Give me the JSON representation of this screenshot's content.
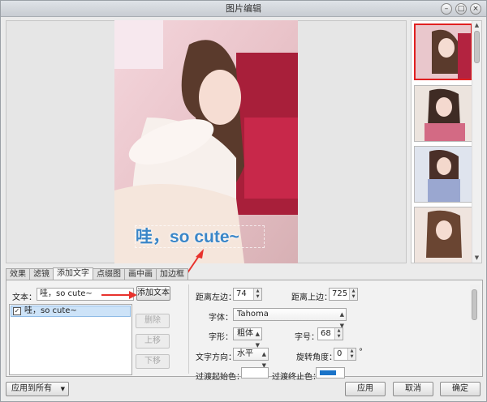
{
  "window": {
    "title": "图片编辑",
    "minimize_icon": "minimize-icon",
    "maximize_icon": "maximize-icon",
    "close_icon": "close-icon"
  },
  "preview": {
    "overlay_text": "哇，so cute~",
    "overlay_color": "#3a86c8"
  },
  "thumbnails": {
    "count": 4,
    "selected_index": 0,
    "selected_border": "#e02020"
  },
  "tabs": [
    {
      "label": "效果"
    },
    {
      "label": "滤镜"
    },
    {
      "label": "添加文字"
    },
    {
      "label": "点缀图"
    },
    {
      "label": "画中画"
    },
    {
      "label": "加边框"
    }
  ],
  "active_tab": 2,
  "text_panel": {
    "text_label": "文本：",
    "text_value": "哇，so cute~",
    "add_button": "添加文本",
    "list_items": [
      {
        "label": "哇，so cute~",
        "checked": true
      }
    ],
    "delete_button": "删除",
    "up_button": "上移",
    "down_button": "下移"
  },
  "props": {
    "left_label": "距离左边：",
    "left_value": "74",
    "top_label": "距离上边：",
    "top_value": "725",
    "font_label": "字体：",
    "font_value": "Tahoma",
    "style_label": "字形：",
    "style_value": "粗体",
    "size_label": "字号：",
    "size_value": "68",
    "direction_label": "文字方向：",
    "direction_value": "水平",
    "rotation_label": "旋转角度：",
    "rotation_value": "0",
    "rotation_unit": "°",
    "gradient_start_label": "过渡起始色：",
    "gradient_start_color": "#ffffff",
    "gradient_end_label": "过渡终止色：",
    "gradient_end_color": "#1a73c8"
  },
  "footer": {
    "apply_all": "应用到所有",
    "apply": "应用",
    "cancel": "取消",
    "ok": "确定"
  },
  "accent_arrow_color": "#e8322d"
}
